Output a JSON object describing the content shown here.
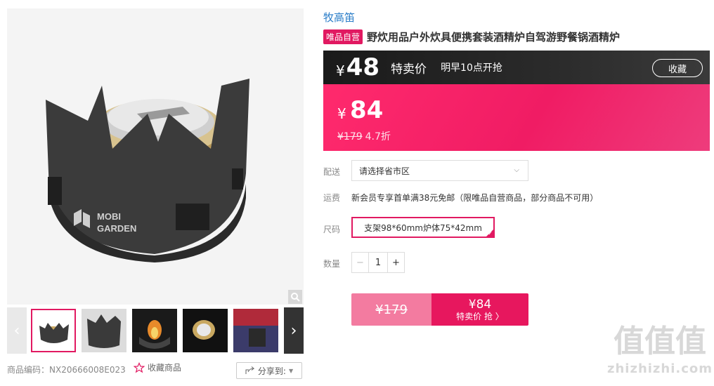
{
  "product": {
    "brand": "牧高笛",
    "badge": "唯品自营",
    "title": "野炊用品户外炊具便携套装酒精炉自驾游野餐锅酒精炉",
    "sku_code_label": "商品编码：",
    "sku_code": "NX20666008E023",
    "collect_label": "收藏商品",
    "share_label": "分享到:"
  },
  "flash_sale": {
    "currency": "¥",
    "price": "48",
    "label": "特卖价",
    "start_time": "明早10点开抢",
    "collect_button": "收藏"
  },
  "price": {
    "currency": "¥",
    "value": "84",
    "original": "¥179",
    "discount": "4.7折"
  },
  "options": {
    "delivery_label": "配送",
    "delivery_placeholder": "请选择省市区",
    "shipping_label": "运费",
    "shipping_text": "新会员专享首单满38元免邮（限唯品自营商品，部分商品不可用）",
    "size_label": "尺码",
    "size_value": "支架98*60mm炉体75*42mm",
    "qty_label": "数量",
    "qty_minus": "−",
    "qty_value": "1",
    "qty_plus": "+"
  },
  "buy_button": {
    "original": "¥179",
    "price": "¥84",
    "action": "特卖价 抢 〉"
  },
  "watermark": {
    "zh": "值值值",
    "en": "zhizhizhi.com"
  },
  "colors": {
    "accent": "#e11961",
    "brand_link": "#2a7dc8",
    "flash_bar": "#1a1a1a"
  }
}
